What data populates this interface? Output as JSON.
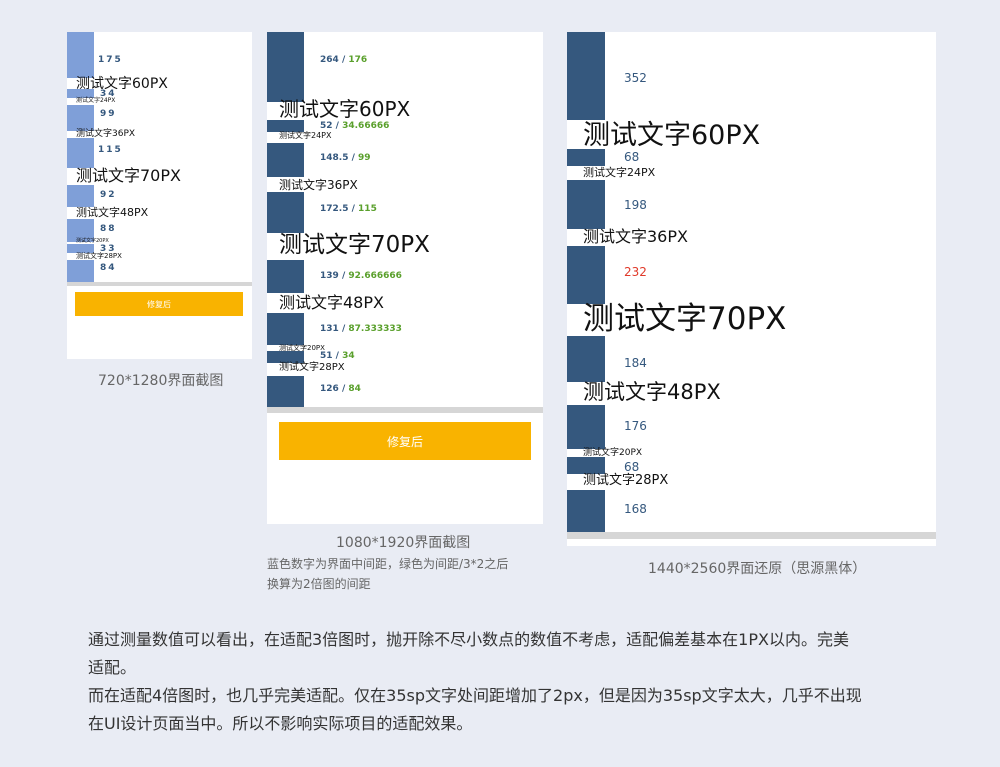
{
  "colors": {
    "bar_light": "#7f9fd8",
    "bar_dark": "#35587e",
    "num_blue": "#35587e",
    "num_green": "#5aa02c",
    "num_red": "#e03a2a",
    "button": "#f9b300",
    "separator": "#d6d6d6"
  },
  "panel1": {
    "numbers": [
      "175",
      "34",
      "99",
      "115",
      "92",
      "88",
      "33",
      "84"
    ],
    "texts": [
      "测试文字60PX",
      "测试文字24PX",
      "测试文字36PX",
      "测试文字70PX",
      "测试文字48PX",
      "测试文字20PX",
      "测试文字28PX"
    ],
    "button": "修复后",
    "caption": "720*1280界面截图"
  },
  "panel2": {
    "measures": [
      {
        "blue": "264",
        "green": "176"
      },
      {
        "blue": "52",
        "green": "34.66666"
      },
      {
        "blue": "148.5",
        "green": "99"
      },
      {
        "blue": "172.5",
        "green": "115"
      },
      {
        "blue": "139",
        "green": "92.666666"
      },
      {
        "blue": "131",
        "green": "87.333333"
      },
      {
        "blue": "51",
        "green": "34"
      },
      {
        "blue": "126",
        "green": "84"
      }
    ],
    "slash": "/",
    "texts": [
      "测试文字60PX",
      "测试文字24PX",
      "测试文字36PX",
      "测试文字70PX",
      "测试文字48PX",
      "测试文字20PX",
      "测试文字28PX"
    ],
    "button": "修复后",
    "caption": "1080*1920界面截图",
    "note_line1": "蓝色数字为界面中间距，绿色为间距/3*2之后",
    "note_line2": "换算为2倍图的间距"
  },
  "panel3": {
    "numbers": [
      "352",
      "68",
      "198",
      "232",
      "184",
      "176",
      "68",
      "168"
    ],
    "texts": [
      "测试文字60PX",
      "测试文字24PX",
      "测试文字36PX",
      "测试文字70PX",
      "测试文字48PX",
      "测试文字20PX",
      "测试文字28PX"
    ],
    "caption": "1440*2560界面还原（思源黑体）"
  },
  "paragraph": {
    "line1": "通过测量数值可以看出，在适配3倍图时，抛开除不尽小数点的数值不考虑，适配偏差基本在1PX以内。完美",
    "line2": "适配。",
    "line3": "而在适配4倍图时，也几乎完美适配。仅在35sp文字处间距增加了2px，但是因为35sp文字太大，几乎不出现",
    "line4": "在UI设计页面当中。所以不影响实际项目的适配效果。"
  }
}
